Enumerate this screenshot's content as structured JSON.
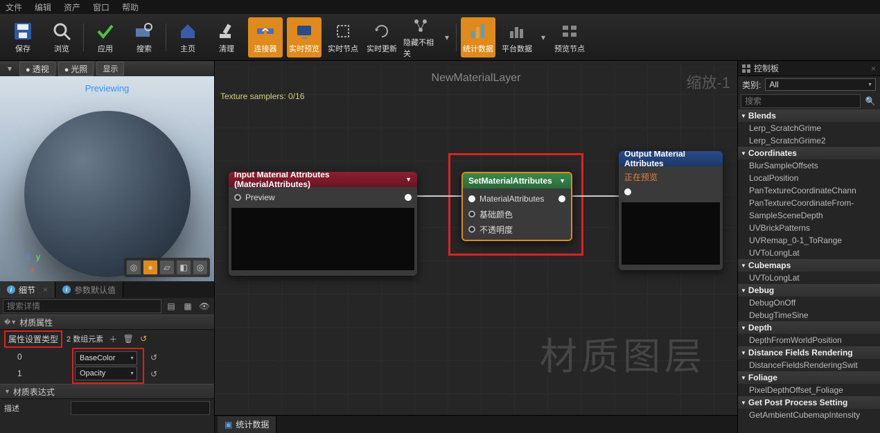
{
  "menu": {
    "file": "文件",
    "edit": "编辑",
    "asset": "资产",
    "window": "窗口",
    "help": "帮助"
  },
  "toolbar": {
    "save": "保存",
    "browse": "浏览",
    "apply": "应用",
    "search": "搜索",
    "home": "主页",
    "clean": "清理",
    "connector": "连接器",
    "live_preview": "实时预览",
    "live_node": "实时节点",
    "live_update": "实时更新",
    "hide_unrelated": "隐藏不相关",
    "stats": "统计数据",
    "platform": "平台数据",
    "preview_node": "预览节点"
  },
  "viewport": {
    "perspective": "透视",
    "lighting": "光照",
    "show": "显示",
    "previewing": "Previewing",
    "axis": {
      "x": "x",
      "y": "y",
      "z": "z"
    }
  },
  "details": {
    "tab_details": "细节",
    "tab_defaults": "参数默认值",
    "search_placeholder": "搜索详情",
    "material_props": "材质属性",
    "attr_setting_type": "属性设置类型",
    "array_count": "2 数组元素",
    "row0_idx": "0",
    "row0_val": "BaseColor",
    "row1_idx": "1",
    "row1_val": "Opacity",
    "material_expr": "材质表达式",
    "desc": "描述"
  },
  "graph": {
    "title": "NewMaterialLayer",
    "samplers": "Texture samplers: 0/16",
    "zoom": "缩放-1",
    "watermark": "材质图层",
    "node_input": {
      "title": "Input Material Attributes (MaterialAttributes)",
      "preview": "Preview"
    },
    "node_set": {
      "title": "SetMaterialAttributes",
      "pin1": "MaterialAttributes",
      "pin2": "基础颜色",
      "pin3": "不透明度"
    },
    "node_out": {
      "title": "Output Material Attributes",
      "preview": "正在预览"
    },
    "stats_tab": "统计数据"
  },
  "palette": {
    "title": "控制板",
    "category_label": "类别:",
    "category_all": "All",
    "search_placeholder": "搜索",
    "groups": [
      {
        "name": "Blends",
        "items": [
          "Lerp_ScratchGrime",
          "Lerp_ScratchGrime2"
        ]
      },
      {
        "name": "Coordinates",
        "items": [
          "BlurSampleOffsets",
          "LocalPosition",
          "PanTextureCoordinateChann",
          "PanTextureCoordinateFrom-",
          "SampleSceneDepth",
          "UVBrickPatterns",
          "UVRemap_0-1_ToRange",
          "UVToLongLat"
        ]
      },
      {
        "name": "Cubemaps",
        "items": [
          "UVToLongLat"
        ]
      },
      {
        "name": "Debug",
        "items": [
          "DebugOnOff",
          "DebugTimeSine"
        ]
      },
      {
        "name": "Depth",
        "items": [
          "DepthFromWorldPosition"
        ]
      },
      {
        "name": "Distance Fields Rendering",
        "items": [
          "DistanceFieldsRenderingSwit"
        ]
      },
      {
        "name": "Foliage",
        "items": [
          "PixelDepthOffset_Foliage"
        ]
      },
      {
        "name": "Get Post Process Setting",
        "items": [
          "GetAmbientCubemapIntensity"
        ]
      }
    ]
  }
}
